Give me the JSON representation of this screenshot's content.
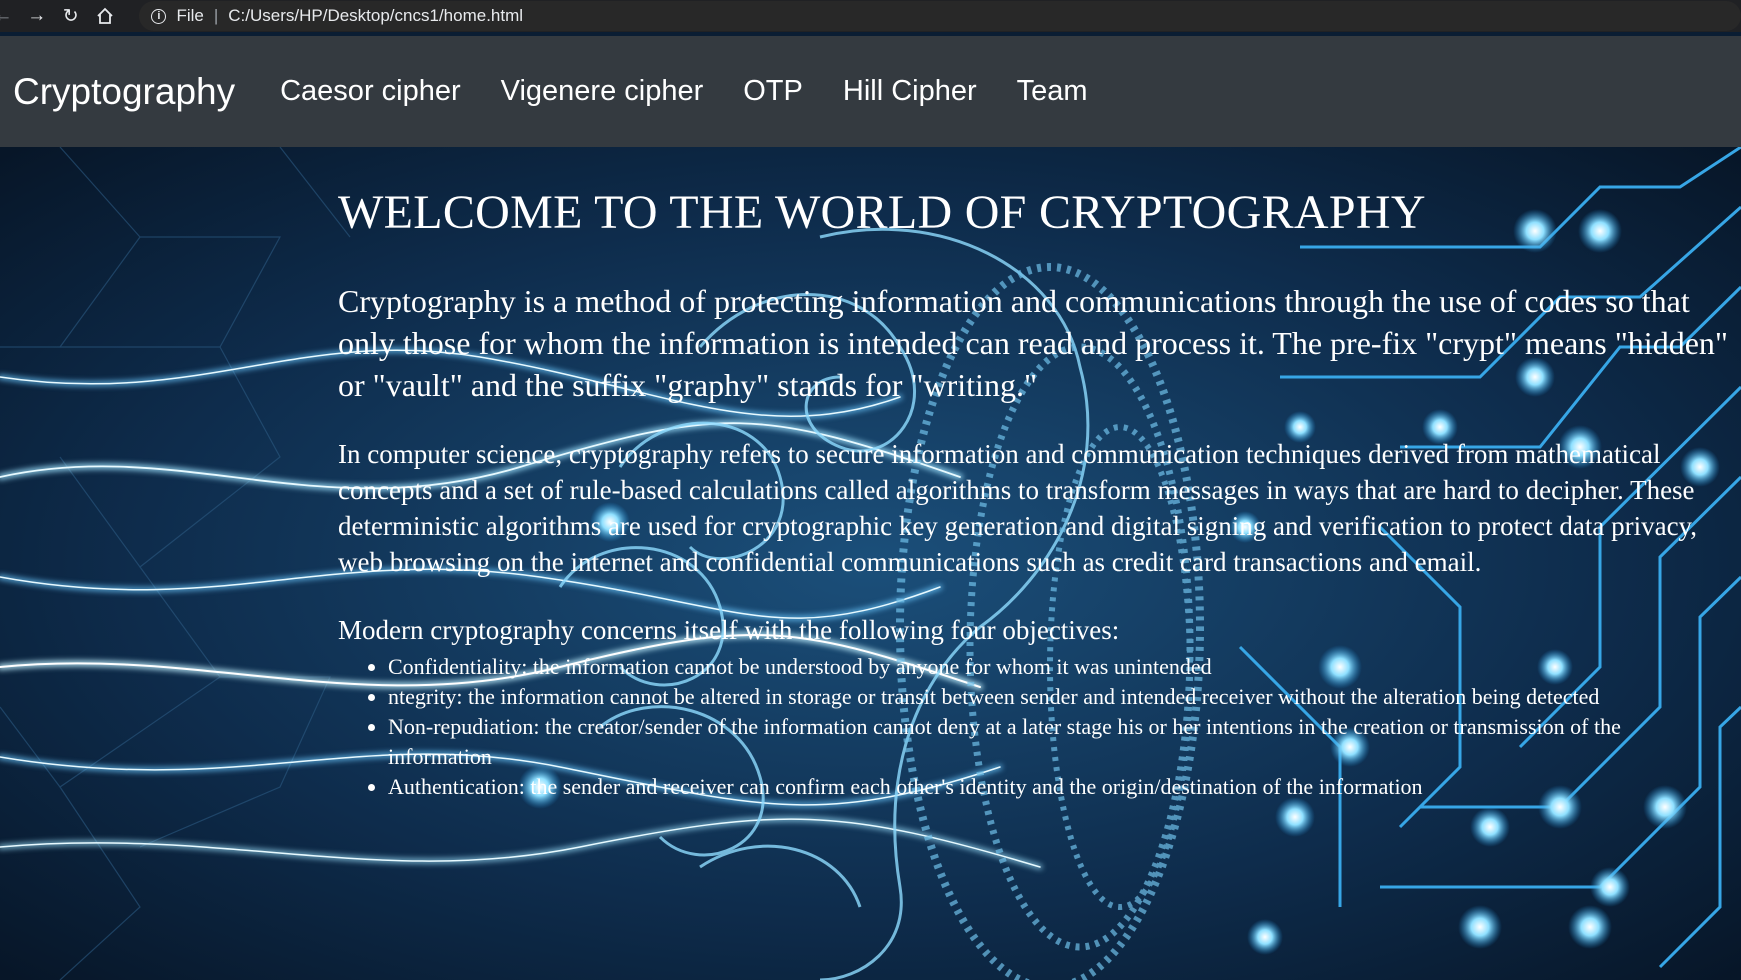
{
  "browser": {
    "scheme": "File",
    "url": "C:/Users/HP/Desktop/cncs1/home.html"
  },
  "navbar": {
    "brand": "Cryptography",
    "links": [
      "Caesor cipher",
      "Vigenere cipher",
      "OTP",
      "Hill Cipher",
      "Team"
    ]
  },
  "main": {
    "heading": "WELCOME TO THE WORLD OF CRYPTOGRAPHY",
    "intro": "Cryptography is a method of protecting information and communications through the use of codes so that only those for whom the information is intended can read and process it. The pre-fix \"crypt\" means \"hidden\" or \"vault\" and the suffix \"graphy\" stands for \"writing.\"",
    "paragraph2": "In computer science, cryptography refers to secure information and communication techniques derived from mathematical concepts and a set of rule-based calculations called algorithms to transform messages in ways that are hard to decipher. These deterministic algorithms are used for cryptographic key generation and digital signing and verification to protect data privacy, web browsing on the internet and confidential communications such as credit card transactions and email.",
    "objectives_intro": "Modern cryptography concerns itself with the following four objectives:",
    "objectives": [
      "Confidentiality: the information cannot be understood by anyone for whom it was unintended",
      "ntegrity: the information cannot be altered in storage or transit between sender and intended receiver without the alteration being detected",
      "Non-repudiation: the creator/sender of the information cannot deny at a later stage his or her intentions in the creation or transmission of the information",
      "Authentication: the sender and receiver can confirm each other's identity and the origin/destination of the information"
    ]
  },
  "colors": {
    "navbar_bg": "#343a40",
    "chrome_bg": "#202124",
    "hero_bg": "#0a1d33",
    "glow": "#7fd4ff"
  },
  "icons": [
    "back-icon",
    "forward-icon",
    "reload-icon",
    "home-icon",
    "info-icon"
  ]
}
